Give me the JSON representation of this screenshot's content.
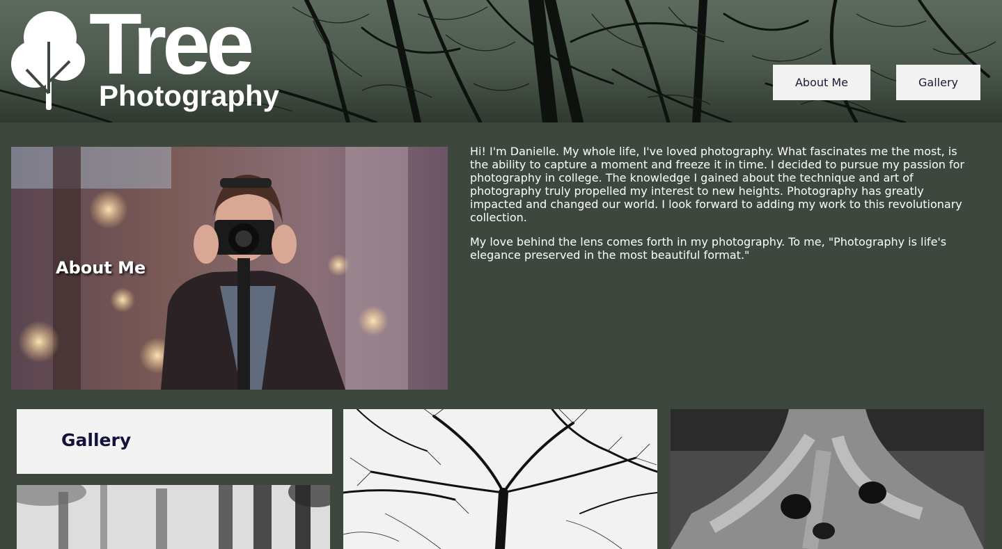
{
  "header": {
    "logo": {
      "word_main": "Tree",
      "word_sub": "Photography",
      "icon": "tree-logo-icon"
    },
    "nav": [
      {
        "label": "About Me"
      },
      {
        "label": "Gallery"
      }
    ]
  },
  "about": {
    "heading": "About Me",
    "paragraphs": [
      "Hi! I'm Danielle. My whole life, I've loved photography. What fascinates me the most, is the ability to capture a moment and freeze it in time. I decided to pursue my passion for photography in college. The knowledge I gained about the technique and art of photography truly propelled my interest to new heights. Photography has greatly impacted and changed our world. I look forward to adding my work to this revolutionary collection.",
      "My love behind the lens comes forth in my photography. To me, \"Photography is life's elegance preserved in the most beautiful format.\""
    ]
  },
  "gallery": {
    "heading": "Gallery"
  },
  "colors": {
    "page_bg": "#3d473d",
    "button_bg": "#f3f3f3",
    "button_text": "#1a1a33",
    "gallery_heading": "#14123a"
  }
}
